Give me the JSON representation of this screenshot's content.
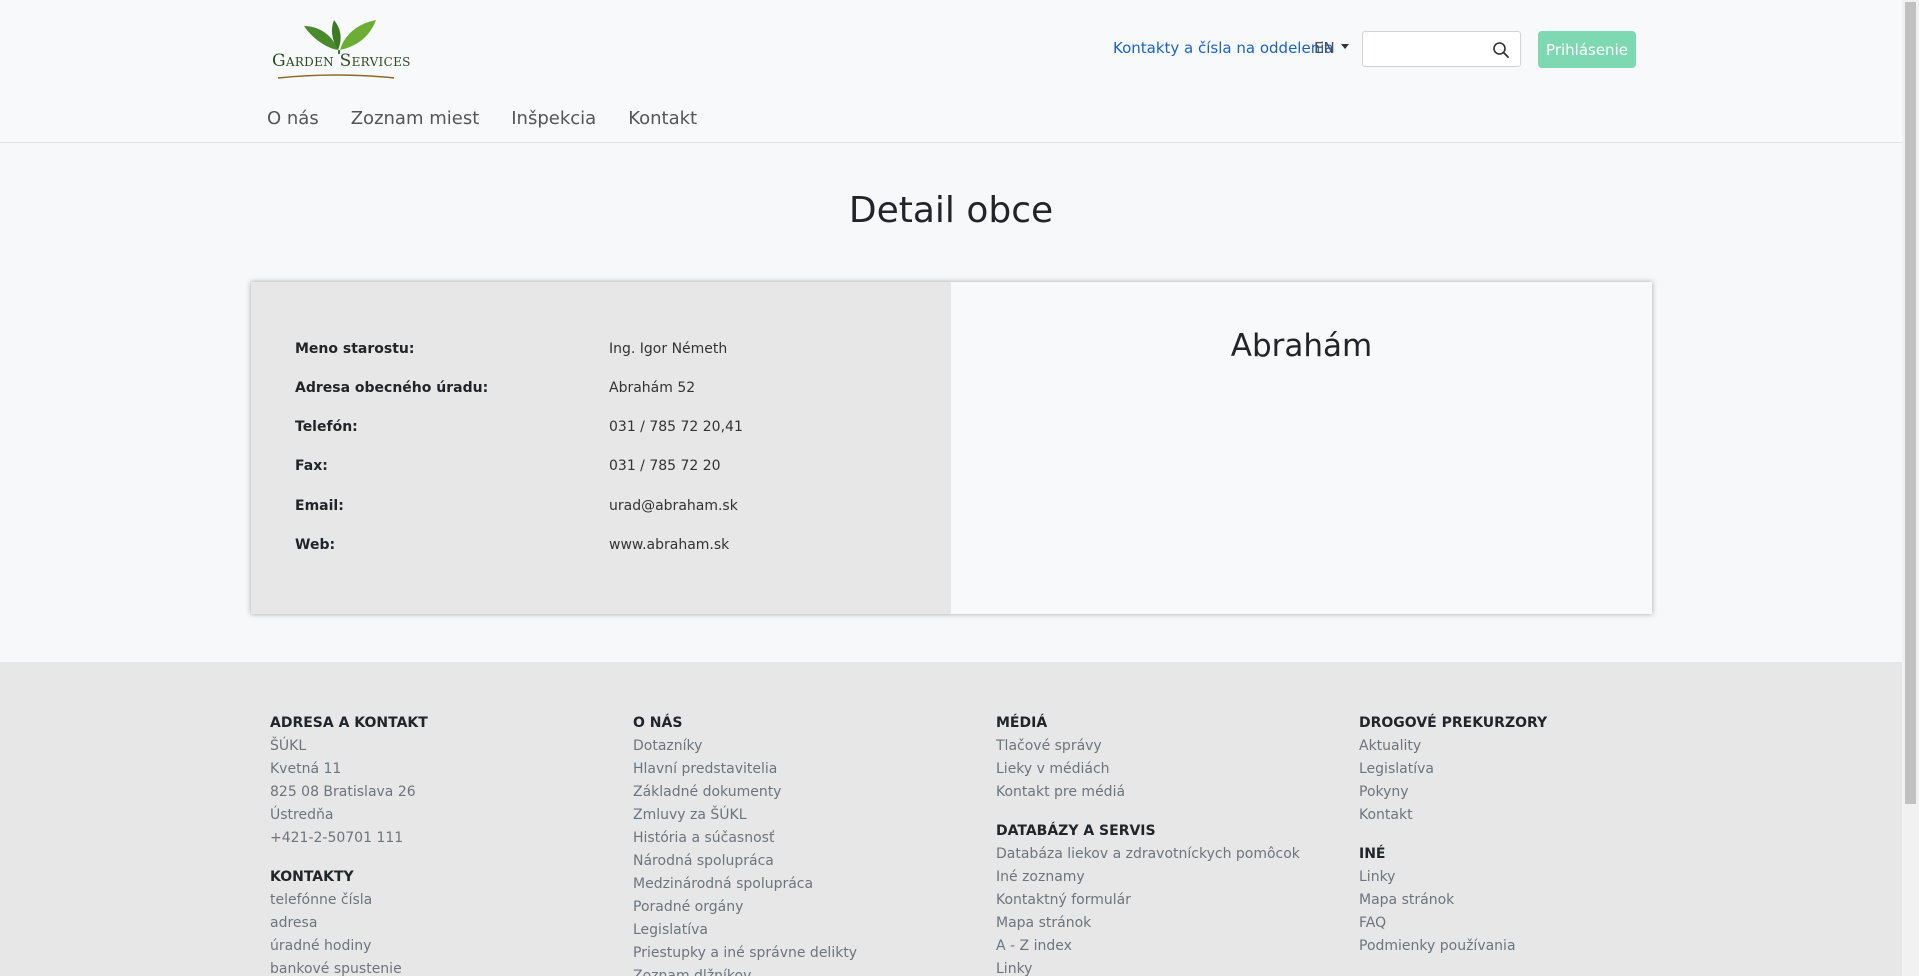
{
  "header": {
    "logo_text": "Garden Services",
    "contacts_link": "Kontakty a čísla na oddelenia",
    "language": "EN",
    "search_placeholder": "",
    "login_label": "Prihlásenie"
  },
  "nav": {
    "items": [
      {
        "label": "O nás"
      },
      {
        "label": "Zoznam miest"
      },
      {
        "label": "Inšpekcia"
      },
      {
        "label": "Kontakt"
      }
    ]
  },
  "main": {
    "title": "Detail obce",
    "town_name": "Abrahám",
    "details": [
      {
        "label": "Meno starostu:",
        "value": "Ing. Igor Németh"
      },
      {
        "label": "Adresa obecného úradu:",
        "value": "Abrahám 52"
      },
      {
        "label": "Telefón:",
        "value": "031 / 785 72 20,41"
      },
      {
        "label": "Fax:",
        "value": "031 / 785 72 20"
      },
      {
        "label": "Email:",
        "value": "urad@abraham.sk"
      },
      {
        "label": "Web:",
        "value": "www.abraham.sk"
      }
    ]
  },
  "footer": {
    "col1": {
      "heading1": "ADRESA A KONTAKT",
      "items1": [
        "ŠÚKL",
        "Kvetná 11",
        "825 08 Bratislava 26",
        "Ústredňa",
        "+421-2-50701 111"
      ],
      "heading2": "KONTAKTY",
      "items2": [
        "telefónne čísla",
        "adresa",
        "úradné hodiny",
        "bankové spustenie"
      ]
    },
    "col2": {
      "heading1": "O NÁS",
      "items1": [
        "Dotazníky",
        "Hlavní predstavitelia",
        "Základné dokumenty",
        "Zmluvy za ŠÚKL",
        "História a súčasnosť",
        "Národná spolupráca",
        "Medzinárodná spolupráca",
        "Poradné orgány",
        "Legislatíva",
        "Priestupky a iné správne delikty",
        "Zoznam dlžníkov"
      ]
    },
    "col3": {
      "heading1": "MÉDIÁ",
      "items1": [
        "Tlačové správy",
        "Lieky v médiách",
        "Kontakt pre médiá"
      ],
      "heading2": "DATABÁZY A SERVIS",
      "items2": [
        "Databáza liekov a zdravotníckych pomôcok",
        "Iné zoznamy",
        "Kontaktný formulár",
        "Mapa stránok",
        "A - Z index",
        "Linky"
      ]
    },
    "col4": {
      "heading1": "DROGOVÉ PREKURZORY",
      "items1": [
        "Aktuality",
        "Legislatíva",
        "Pokyny",
        "Kontakt"
      ],
      "heading2": "INÉ",
      "items2": [
        "Linky",
        "Mapa stránok",
        "FAQ",
        "Podmienky používania"
      ]
    }
  }
}
